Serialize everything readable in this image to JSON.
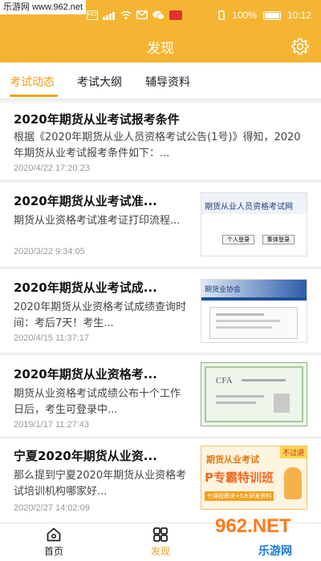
{
  "watermark": "乐游网 www.962.net",
  "status": {
    "battery_percent": "100%",
    "time": "10:12",
    "hd_label": "HD"
  },
  "header": {
    "title": "发现"
  },
  "tabs": [
    {
      "label": "考试动态",
      "active": true
    },
    {
      "label": "考试大纲",
      "active": false
    },
    {
      "label": "辅导资料",
      "active": false
    }
  ],
  "articles": [
    {
      "title": "2020年期货从业考试报考条件",
      "desc": "根据《2020年期货从业人员资格考试公告(1号)》得知，2020年期货从业考试报考条件如下：...",
      "date": "2020/4/22 17:20:23",
      "thumb": ""
    },
    {
      "title": "2020年期货从业考试准...",
      "desc": "期货从业资格考试准考证打印流程...",
      "date": "2020/3/22 9:34:05",
      "thumb": "exam-website-screenshot",
      "thumb_text": "期货从业人员资格考试网",
      "thumb_buttons": [
        "个人登录",
        "集体登录"
      ]
    },
    {
      "title": "2020年期货从业考试成...",
      "desc": "2020年期货从业资格考试成绩查询时间：考后7天！考生...",
      "date": "2020/4/15 11:37:17",
      "thumb": "association-website-screenshot",
      "thumb_text": "期货业协会"
    },
    {
      "title": "2020年期货从业资格考...",
      "desc": "期货从业资格考试成绩公布十个工作日后，考生可登录中...",
      "date": "2019/1/17 11:27:43",
      "thumb": "certificate-image",
      "thumb_text": "CFA"
    },
    {
      "title": "宁夏2020年期货从业资...",
      "desc": "那么提到宁夏2020年期货从业资格考试培训机构哪家好...",
      "date": "2020/2/27 14:02:09",
      "thumb": "training-banner",
      "thumb_text": "期货从业考试",
      "thumb_banner": "P专霸特训班",
      "thumb_tag": "不过退",
      "thumb_sub": "七课程模块+5大研发资料"
    }
  ],
  "bottom_nav": [
    {
      "label": "首页",
      "icon": "home-icon",
      "active": false
    },
    {
      "label": "发现",
      "icon": "grid-icon",
      "active": true
    }
  ],
  "corner_watermark": "962.NET",
  "corner_watermark_sub": "乐游网",
  "colors": {
    "accent": "#f5b533",
    "tab_active": "#f0a21a"
  }
}
